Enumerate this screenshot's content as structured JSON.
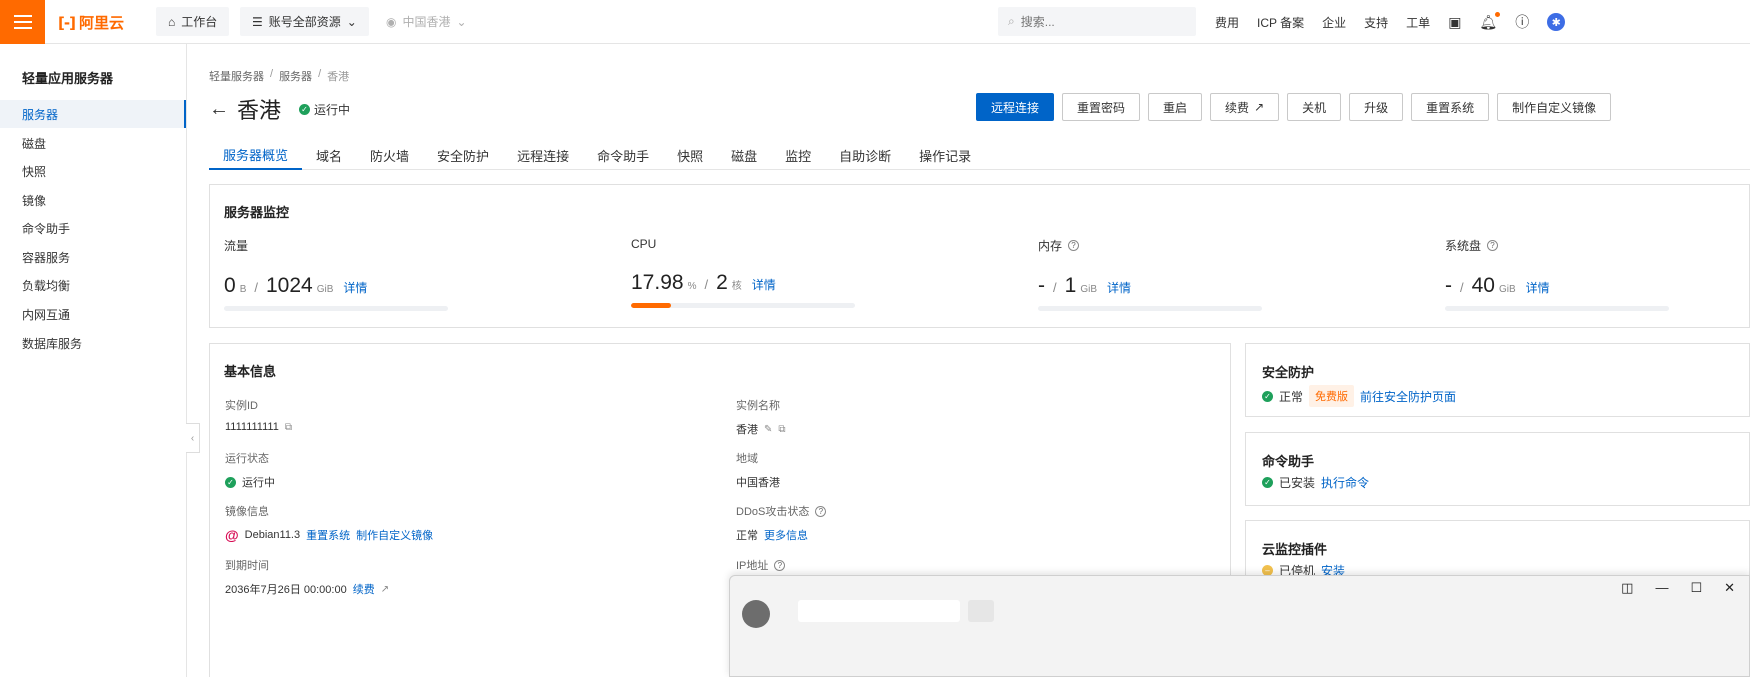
{
  "topbar": {
    "logo_text": "阿里云",
    "workbench": "工作台",
    "resource_scope": "账号全部资源",
    "region": "中国香港",
    "search_placeholder": "搜索...",
    "links": [
      "费用",
      "ICP 备案",
      "企业",
      "支持",
      "工单"
    ]
  },
  "sidebar": {
    "title": "轻量应用服务器",
    "items": [
      "服务器",
      "磁盘",
      "快照",
      "镜像",
      "命令助手",
      "容器服务",
      "负载均衡",
      "内网互通",
      "数据库服务"
    ],
    "active_index": 0
  },
  "breadcrumb": [
    "轻量服务器",
    "服务器",
    "香港"
  ],
  "page": {
    "title": "香港",
    "status": "运行中"
  },
  "actions": [
    "远程连接",
    "重置密码",
    "重启",
    "续费",
    "关机",
    "升级",
    "重置系统",
    "制作自定义镜像"
  ],
  "tabs": [
    "服务器概览",
    "域名",
    "防火墙",
    "安全防护",
    "远程连接",
    "命令助手",
    "快照",
    "磁盘",
    "监控",
    "自助诊断",
    "操作记录"
  ],
  "monitor": {
    "title": "服务器监控",
    "traffic": {
      "label": "流量",
      "used": "0",
      "used_unit": "B",
      "total": "1024",
      "total_unit": "GiB",
      "link": "详情",
      "fraction": 0.0
    },
    "cpu": {
      "label": "CPU",
      "used": "17.98",
      "used_unit": "%",
      "total": "2",
      "total_unit": "核",
      "link": "详情",
      "fraction": 0.1798
    },
    "memory": {
      "label": "内存",
      "used": "-",
      "total": "1",
      "total_unit": "GiB",
      "link": "详情",
      "fraction": 0.0
    },
    "disk": {
      "label": "系统盘",
      "used": "-",
      "total": "40",
      "total_unit": "GiB",
      "link": "详情",
      "fraction": 0.0
    }
  },
  "basic_info": {
    "title": "基本信息",
    "instance_id_label": "实例ID",
    "instance_id": "1111111111",
    "instance_name_label": "实例名称",
    "instance_name": "香港",
    "run_state_label": "运行状态",
    "run_state": "运行中",
    "region_label": "地域",
    "region": "中国香港",
    "image_label": "镜像信息",
    "image": "Debian11.3",
    "image_link1": "重置系统",
    "image_link2": "制作自定义镜像",
    "ddos_label": "DDoS攻击状态",
    "ddos_state": "正常",
    "ddos_link": "更多信息",
    "expire_label": "到期时间",
    "expire": "2036年7月26日 00:00:00",
    "renew_link": "续费",
    "ip_label": "IP地址"
  },
  "security": {
    "title": "安全防护",
    "state": "正常",
    "badge": "免费版",
    "link": "前往安全防护页面"
  },
  "command": {
    "title": "命令助手",
    "state": "已安装",
    "link": "执行命令"
  },
  "cloudmonitor": {
    "title": "云监控插件",
    "state": "已停机",
    "link": "安装"
  }
}
